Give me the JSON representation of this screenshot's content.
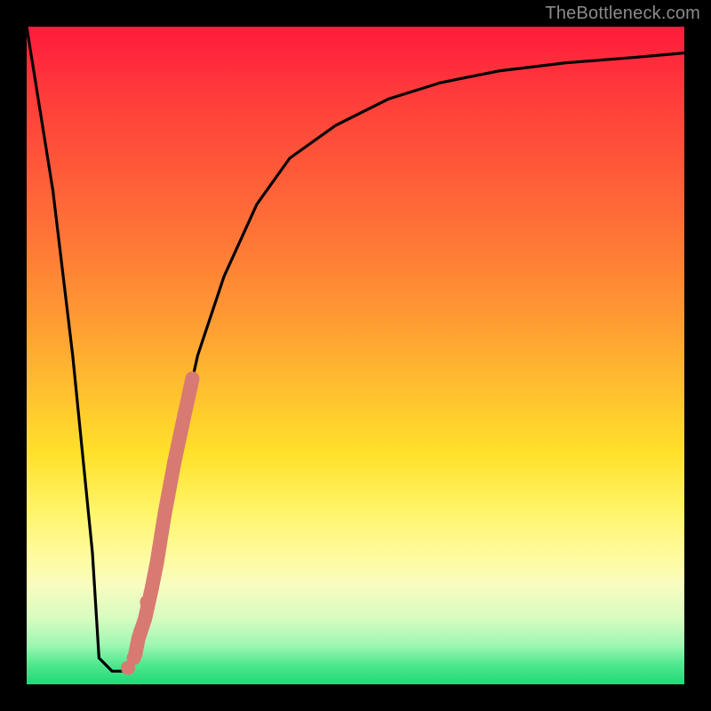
{
  "source_label": "TheBottleneck.com",
  "chart_data": {
    "type": "line",
    "title": "",
    "xlabel": "",
    "ylabel": "",
    "xlim": [
      0,
      100
    ],
    "ylim": [
      0,
      100
    ],
    "series": [
      {
        "name": "bottleneck-curve",
        "x": [
          0,
          4,
          7,
          10,
          11,
          13,
          15,
          18,
          20,
          22,
          24,
          26,
          30,
          35,
          40,
          47,
          55,
          63,
          72,
          82,
          92,
          100
        ],
        "y": [
          100,
          75,
          50,
          20,
          4,
          2,
          2,
          10,
          20,
          31,
          41,
          50,
          62,
          73,
          80,
          85,
          89,
          91.5,
          93.3,
          94.5,
          95.3,
          96
        ]
      }
    ],
    "highlight_segment": {
      "name": "thick-salmon-segment",
      "color": "#d87a72",
      "x": [
        16.5,
        17.0,
        18.0,
        19.0,
        19.8,
        21.0,
        22.5,
        24.0,
        25.2
      ],
      "y": [
        4.5,
        7.0,
        10.0,
        14.5,
        18.5,
        26.0,
        34.0,
        41.0,
        46.5
      ]
    },
    "highlight_dots": {
      "name": "salmon-dots",
      "color": "#d87a72",
      "points": [
        {
          "x": 15.4,
          "y": 2.5
        },
        {
          "x": 16.3,
          "y": 4.0
        },
        {
          "x": 17.3,
          "y": 8.0
        },
        {
          "x": 18.3,
          "y": 12.5
        }
      ]
    }
  }
}
